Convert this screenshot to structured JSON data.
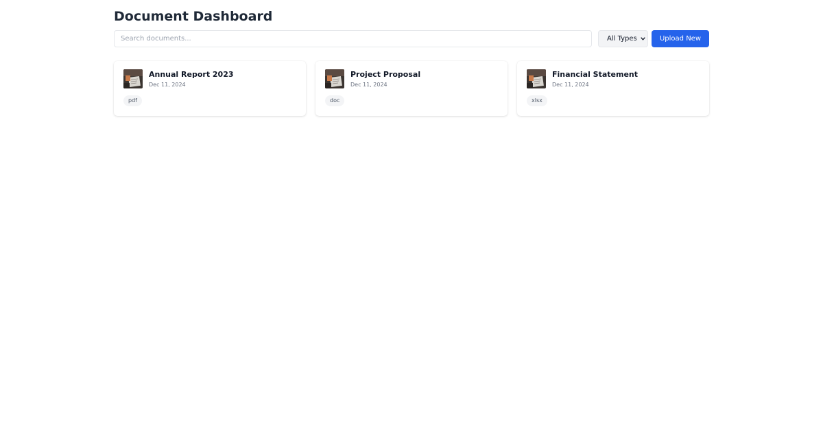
{
  "header": {
    "title": "Document Dashboard"
  },
  "toolbar": {
    "search_placeholder": "Search documents...",
    "search_value": "",
    "type_filter_selected": "All Types",
    "upload_label": "Upload New"
  },
  "documents": [
    {
      "title": "Annual Report 2023",
      "date": "Dec 11, 2024",
      "type": "pdf"
    },
    {
      "title": "Project Proposal",
      "date": "Dec 11, 2024",
      "type": "doc"
    },
    {
      "title": "Financial Statement",
      "date": "Dec 11, 2024",
      "type": "xlsx"
    }
  ],
  "colors": {
    "accent": "#2563eb",
    "title_text": "#1f2937",
    "muted_text": "#6b7280",
    "tag_background": "#f3f4f6"
  }
}
